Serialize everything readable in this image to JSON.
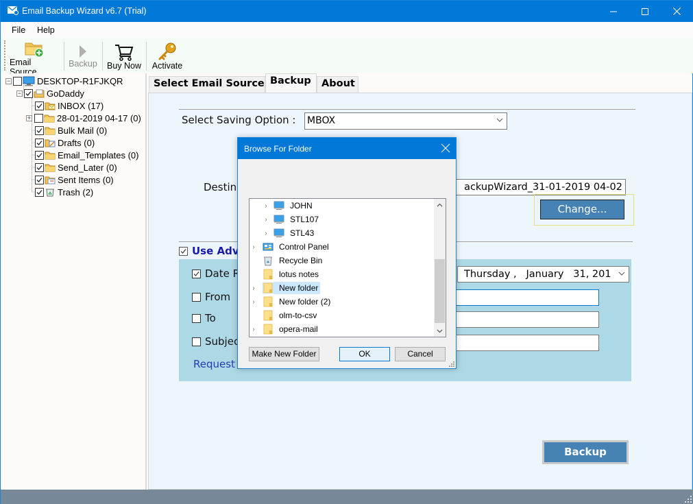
{
  "window": {
    "title": "Email Backup Wizard v6.7 (Trial)",
    "controls": {
      "minimize": "minimize",
      "maximize": "maximize",
      "close": "close"
    }
  },
  "menu": {
    "items": [
      {
        "label": "File"
      },
      {
        "label": "Help"
      }
    ]
  },
  "toolbar": {
    "items": [
      {
        "label": "Email Source",
        "icon": "folder-add-icon",
        "enabled": true
      },
      {
        "label": "Backup",
        "icon": "play-icon",
        "enabled": false
      },
      {
        "label": "Buy Now",
        "icon": "cart-icon",
        "enabled": true
      },
      {
        "label": "Activate",
        "icon": "key-icon",
        "enabled": true
      }
    ]
  },
  "tree": {
    "root": {
      "label": "DESKTOP-R1FJKQR",
      "checked": false,
      "icon": "computer-icon"
    },
    "account": {
      "label": "GoDaddy",
      "checked": true,
      "icon": "mailbox-icon"
    },
    "folders": [
      {
        "label": "INBOX (17)",
        "checked": true,
        "icon": "inbox-folder-icon",
        "expandable": false
      },
      {
        "label": "28-01-2019 04-17 (0)",
        "checked": false,
        "icon": "folder-icon",
        "expandable": true
      },
      {
        "label": "Bulk Mail (0)",
        "checked": true,
        "icon": "folder-icon",
        "expandable": false
      },
      {
        "label": "Drafts (0)",
        "checked": true,
        "icon": "drafts-folder-icon",
        "expandable": false
      },
      {
        "label": "Email_Templates (0)",
        "checked": true,
        "icon": "folder-icon",
        "expandable": false
      },
      {
        "label": "Send_Later (0)",
        "checked": true,
        "icon": "folder-icon",
        "expandable": false
      },
      {
        "label": "Sent Items (0)",
        "checked": true,
        "icon": "sent-folder-icon",
        "expandable": false
      },
      {
        "label": "Trash (2)",
        "checked": true,
        "icon": "trash-icon",
        "expandable": false
      }
    ]
  },
  "tabs": [
    {
      "label": "Select Email Source",
      "active": false
    },
    {
      "label": "Backup",
      "active": true
    },
    {
      "label": "About",
      "active": false
    }
  ],
  "backup": {
    "saving_option_label": "Select Saving Option :",
    "saving_option_value": "MBOX",
    "destination_label": "Destina",
    "destination_value": "ackupWizard_31-01-2019 04-02",
    "change_button": "Change...",
    "use_advance_label": "Use Adva",
    "use_advance_checked": true,
    "filters": [
      {
        "label": "Date R",
        "checked": true
      },
      {
        "label": "From",
        "checked": false
      },
      {
        "label": "To",
        "checked": false
      },
      {
        "label": "Subjec",
        "checked": false
      }
    ],
    "date_value": "Thursday ,   January   31, 201",
    "from_value": "",
    "to_value": "",
    "subject_value": "",
    "request_link": "Request",
    "backup_button": "Backup"
  },
  "dialog": {
    "title": "Browse For Folder",
    "items": [
      {
        "label": "JOHN",
        "icon": "computer-icon",
        "expandable": true,
        "indent": 1,
        "selected": false
      },
      {
        "label": "STL107",
        "icon": "computer-icon",
        "expandable": true,
        "indent": 1,
        "selected": false
      },
      {
        "label": "STL43",
        "icon": "computer-icon",
        "expandable": true,
        "indent": 1,
        "selected": false
      },
      {
        "label": "Control Panel",
        "icon": "control-panel-icon",
        "expandable": true,
        "indent": 0,
        "selected": false
      },
      {
        "label": "Recycle Bin",
        "icon": "recycle-bin-icon",
        "expandable": false,
        "indent": 0,
        "selected": false
      },
      {
        "label": "lotus notes",
        "icon": "folder-icon",
        "expandable": false,
        "indent": 0,
        "selected": false
      },
      {
        "label": "New folder",
        "icon": "folder-icon",
        "expandable": true,
        "indent": 0,
        "selected": true
      },
      {
        "label": "New folder (2)",
        "icon": "folder-icon",
        "expandable": true,
        "indent": 0,
        "selected": false
      },
      {
        "label": "olm-to-csv",
        "icon": "folder-icon",
        "expandable": false,
        "indent": 0,
        "selected": false
      },
      {
        "label": "opera-mail",
        "icon": "folder-icon",
        "expandable": true,
        "indent": 0,
        "selected": false
      }
    ],
    "buttons": {
      "make_new_folder": "Make New Folder",
      "ok": "OK",
      "cancel": "Cancel"
    }
  },
  "colors": {
    "titlebar": "#0078d7",
    "accent_button": "#4682b4",
    "advanced_panel": "#add8e6",
    "statusbar": "#778899",
    "selection": "#cce8ff"
  }
}
